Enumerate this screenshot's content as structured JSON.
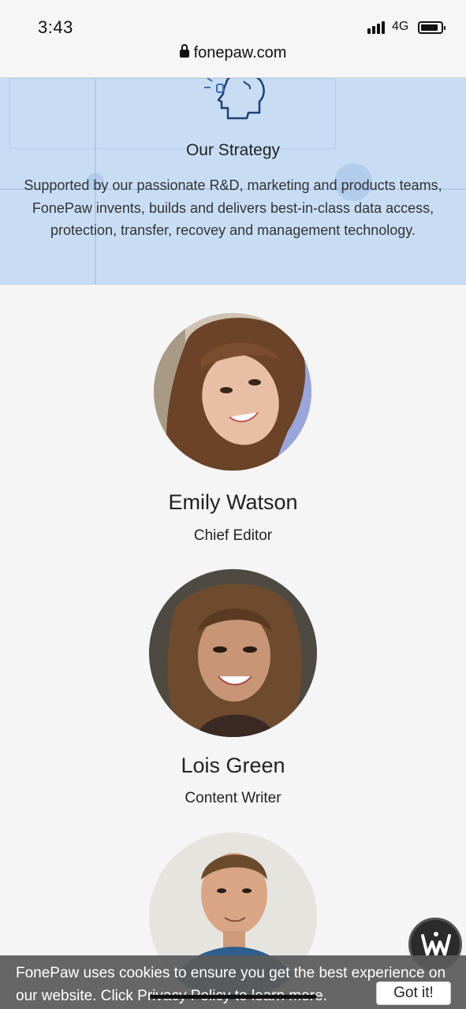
{
  "status_bar": {
    "time": "3:43",
    "network": "4G",
    "battery_level": 0.8
  },
  "browser": {
    "url": "fonepaw.com",
    "lock_icon": "lock-icon"
  },
  "strategy": {
    "icon": "head-lightbulb-icon",
    "title": "Our Strategy",
    "text": "Supported by our passionate R&D, marketing and products teams, FonePaw invents, builds and delivers best-in-class data access, protection, transfer, recovey and management technology."
  },
  "team": [
    {
      "name": "Emily Watson",
      "role": "Chief Editor"
    },
    {
      "name": "Lois Green",
      "role": "Content Writer"
    },
    {
      "name": "",
      "role": ""
    }
  ],
  "chat_widget": {
    "icon": "chat-logo-icon"
  },
  "cookie_bar": {
    "text": "FonePaw uses cookies to ensure you get the best experience on our website. Click Privacy Policy to learn more.",
    "button_label": "Got it!"
  },
  "colors": {
    "banner_bg": "#c8ddf4",
    "page_bg": "#f5f5f5",
    "cookie_bg": "#5a5a5a"
  }
}
